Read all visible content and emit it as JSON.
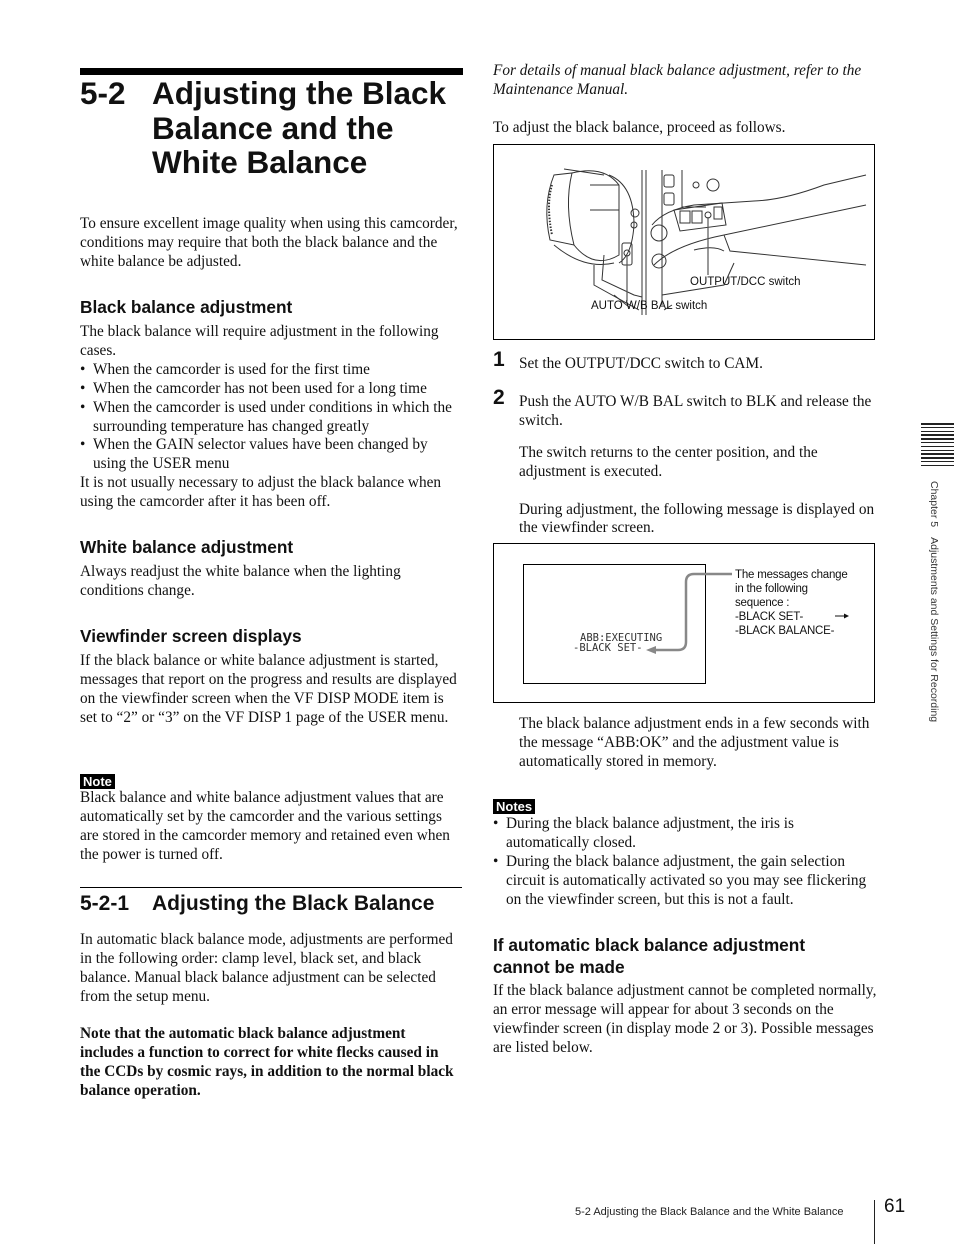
{
  "title": {
    "number": "5-2",
    "lines": [
      "Adjusting the Black",
      "Balance and the",
      "White Balance"
    ]
  },
  "intro": "To ensure excellent image quality when using this camcorder, conditions may require that both the black balance and the white balance be adjusted.",
  "black_balance": {
    "heading": "Black balance adjustment",
    "lead": "The black balance will require adjustment in the following cases.",
    "bullets": [
      "When the camcorder is used for the first time",
      "When the camcorder has not been used for a long time",
      "When the camcorder is used under conditions in which the surrounding temperature has changed greatly",
      "When the GAIN selector values have been changed by using the USER menu"
    ],
    "tail": "It is not usually necessary to adjust the black balance when using the camcorder after it has been off."
  },
  "white_balance": {
    "heading": "White balance adjustment",
    "text": "Always readjust the white balance when the lighting conditions change."
  },
  "viewfinder": {
    "heading": "Viewfinder screen displays",
    "text": "If the black balance or white balance adjustment is started, messages that report on the progress and results are displayed on the viewfinder screen when the VF DISP MODE item is set to “2” or “3” on the VF DISP 1 page of the USER menu."
  },
  "note": {
    "label": "Note",
    "text": "Black balance and white balance adjustment values that are automatically set by the camcorder and the various settings are stored in the camcorder memory and retained even when the power is turned off."
  },
  "section_521": {
    "number": "5-2-1",
    "title": "Adjusting the Black Balance",
    "text": "In automatic black balance mode, adjustments are performed in the following order:  clamp level, black set, and black balance. Manual black balance adjustment can be selected from the setup menu.",
    "bold_note": "Note that the automatic black balance adjustment includes a function to correct for white flecks caused in the CCDs by cosmic rays, in addition to the normal black balance operation."
  },
  "right": {
    "italic_ref": "For details of manual black balance adjustment, refer to the Maintenance Manual.",
    "proceed": "To adjust the black balance, proceed as follows.",
    "figure1": {
      "label_output": "OUTPUT/DCC switch",
      "label_auto": "AUTO W/B BAL switch"
    },
    "steps": [
      {
        "num": "1",
        "text": "Set the OUTPUT/DCC switch to CAM."
      },
      {
        "num": "2",
        "text": "Push the AUTO W/B BAL switch to BLK and release the switch."
      }
    ],
    "step2_para1": "The switch returns to the center position, and the adjustment is executed.",
    "step2_para2": "During adjustment, the following message is displayed on the viewfinder screen.",
    "figure2": {
      "screen_line1": "ABB:EXECUTING",
      "screen_line2": "-BLACK SET-",
      "callout_lines": [
        "The messages change",
        "in the following",
        "sequence :",
        "-BLACK SET-",
        "-BLACK BALANCE-"
      ]
    },
    "after_fig": "The black balance adjustment ends in a few seconds with the message “ABB:OK” and the adjustment value is automatically stored in memory.",
    "notes": {
      "label": "Notes",
      "items": [
        "During the black balance adjustment, the iris is automatically closed.",
        "During the black balance adjustment, the gain selection circuit is automatically activated so you may see flickering on the viewfinder screen, but this is not a fault."
      ]
    },
    "failure": {
      "heading": "If automatic black balance adjustment cannot be made",
      "text": "If the black balance adjustment cannot be completed normally, an error message will appear for about 3 seconds on the viewfinder screen (in display mode 2 or 3). Possible messages are listed below."
    }
  },
  "side_tab": {
    "chapter": "Chapter 5",
    "title": "Adjustments and Settings for Recording"
  },
  "footer": {
    "running_title": "5-2 Adjusting the Black Balance and the White Balance",
    "page_number": "61"
  }
}
